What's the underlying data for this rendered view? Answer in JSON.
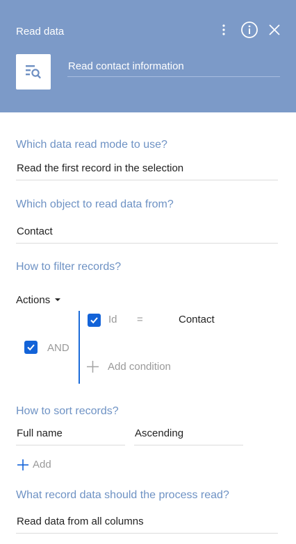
{
  "header": {
    "title": "Read data",
    "element_icon": "read-data-icon",
    "caption_value": "Read contact information",
    "icons": [
      "more-vertical-icon",
      "info-icon",
      "close-icon"
    ],
    "background_color": "#7c9ac8"
  },
  "read_mode": {
    "label": "Which data read mode to use?",
    "value": "Read the first record in the selection"
  },
  "object": {
    "label": "Which object to read data from?",
    "value": "Contact"
  },
  "filter": {
    "label": "How to filter records?",
    "actions_label": "Actions",
    "group_operator": "AND",
    "group_checked": true,
    "condition": {
      "checked": true,
      "column": "Id",
      "operator": "=",
      "value": "Contact"
    },
    "add_condition_label": "Add condition"
  },
  "sort": {
    "label": "How to sort records?",
    "column_value": "Full name",
    "direction_value": "Ascending",
    "add_label": "Add"
  },
  "columns": {
    "label": "What record data should the process read?",
    "value": "Read data from all columns"
  },
  "colors": {
    "accent": "#1363d8",
    "label_blue": "#6e92c4"
  }
}
